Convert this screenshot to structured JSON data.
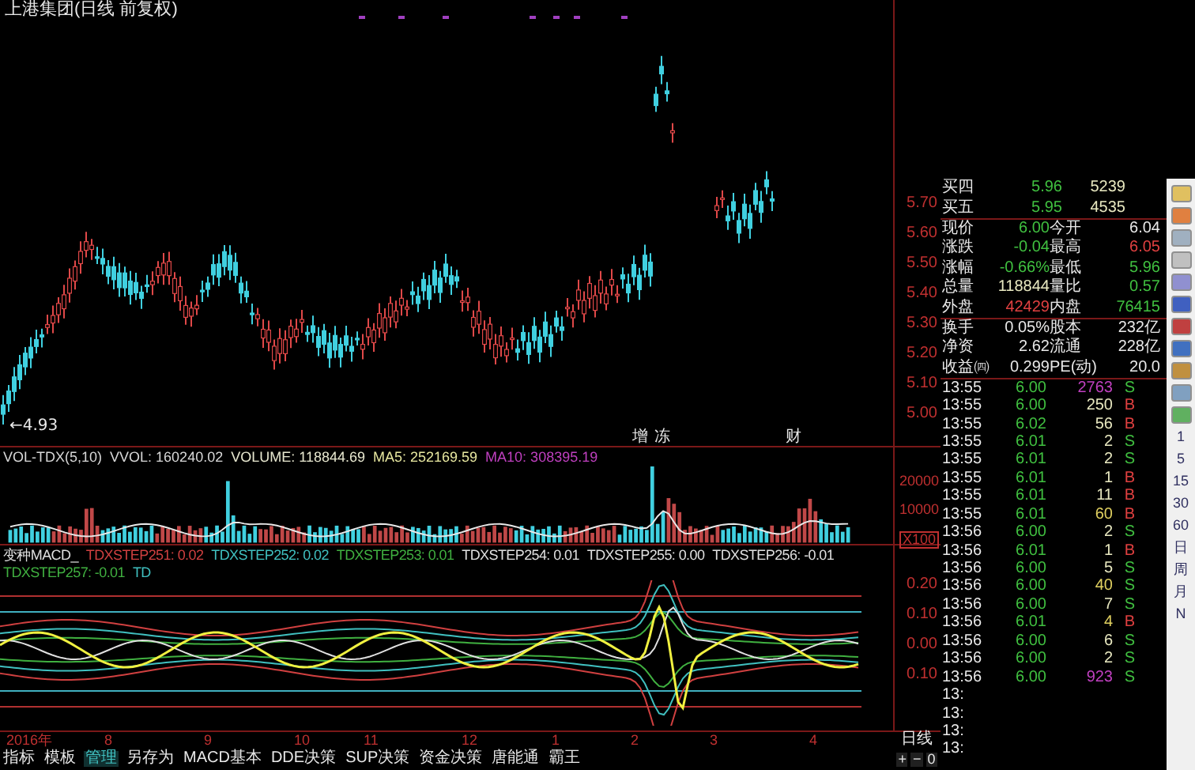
{
  "title": "上港集团(日线 前复权)",
  "low_label": "←4.93",
  "price_axis": [
    "5.70",
    "5.60",
    "5.50",
    "5.40",
    "5.30",
    "5.20",
    "5.10",
    "5.00"
  ],
  "event_marks": [
    {
      "text": "增"
    },
    {
      "text": "冻"
    },
    {
      "text": "财"
    }
  ],
  "volume_legend": [
    {
      "text": "VOL-TDX(5,10)",
      "color": "#d8d8d8"
    },
    {
      "text": "VVOL: 160240.02",
      "color": "#d8d8d8"
    },
    {
      "text": "VOLUME: 118844.69",
      "color": "#e8e8d0"
    },
    {
      "text": "MA5: 252169.59",
      "color": "#e8e8a0"
    },
    {
      "text": "MA10: 308395.19",
      "color": "#c040c0"
    }
  ],
  "volume_axis": [
    "20000",
    "10000",
    "X100"
  ],
  "macd_legend": [
    {
      "text": "变种MACD_",
      "color": "#e0e0e0"
    },
    {
      "text": "TDXSTEP251: 0.02",
      "color": "#d04040"
    },
    {
      "text": "TDXSTEP252: 0.02",
      "color": "#40c0c0"
    },
    {
      "text": "TDXSTEP253: 0.01",
      "color": "#40b040"
    },
    {
      "text": "TDXSTEP254: 0.01",
      "color": "#e0e0e0"
    },
    {
      "text": "TDXSTEP255: 0.00",
      "color": "#e0e0e0"
    },
    {
      "text": "TDXSTEP256: -0.01",
      "color": "#e0e0e0"
    },
    {
      "text": "TDXSTEP257: -0.01",
      "color": "#40b040"
    },
    {
      "text": "TD",
      "color": "#40c0c0"
    }
  ],
  "macd_axis": [
    "0.20",
    "0.10",
    "0.00",
    "0.10"
  ],
  "date_axis": [
    "2016年",
    "8",
    "9",
    "10",
    "11",
    "12",
    "1",
    "2",
    "3",
    "4"
  ],
  "period_label": "日线",
  "zoom_controls": [
    "+",
    "−",
    "0"
  ],
  "tabs": [
    {
      "label": "指标",
      "selected": false
    },
    {
      "label": "模板",
      "selected": false
    },
    {
      "label": "管理",
      "selected": true
    },
    {
      "label": "另存为",
      "selected": false
    },
    {
      "label": "MACD基本",
      "selected": false
    },
    {
      "label": "DDE决策",
      "selected": false
    },
    {
      "label": "SUP决策",
      "selected": false
    },
    {
      "label": "资金决策",
      "selected": false
    },
    {
      "label": "唐能通",
      "selected": false
    },
    {
      "label": "霸王",
      "selected": false
    }
  ],
  "order_book": [
    {
      "label": "买四",
      "price": "5.96",
      "volume": "5239"
    },
    {
      "label": "买五",
      "price": "5.95",
      "volume": "4535"
    }
  ],
  "stats": [
    [
      {
        "label": "现价",
        "value": "6.00",
        "color": "#40c040"
      },
      {
        "label": "今开",
        "value": "6.04",
        "color": "#e8e8e8"
      }
    ],
    [
      {
        "label": "涨跌",
        "value": "-0.04",
        "color": "#40c040"
      },
      {
        "label": "最高",
        "value": "6.05",
        "color": "#e04040"
      }
    ],
    [
      {
        "label": "涨幅",
        "value": "-0.66%",
        "color": "#40c040"
      },
      {
        "label": "最低",
        "value": "5.96",
        "color": "#40c040"
      }
    ],
    [
      {
        "label": "总量",
        "value": "118844",
        "color": "#e8e8c0"
      },
      {
        "label": "量比",
        "value": "0.57",
        "color": "#40c040"
      }
    ],
    [
      {
        "label": "外盘",
        "value": "42429",
        "color": "#e04040"
      },
      {
        "label": "内盘",
        "value": "76415",
        "color": "#40c040"
      }
    ]
  ],
  "fundamentals": [
    [
      {
        "label": "换手",
        "value": "0.05%"
      },
      {
        "label": "股本",
        "value": "232亿"
      }
    ],
    [
      {
        "label": "净资",
        "value": "2.62"
      },
      {
        "label": "流通",
        "value": "228亿"
      }
    ],
    [
      {
        "label": "收益㈣",
        "value": "0.299"
      },
      {
        "label": "PE(动)",
        "value": "20.0"
      }
    ]
  ],
  "ticks": [
    {
      "time": "13:55",
      "price": "6.00",
      "volume": {
        "text": "2763",
        "color": "#c040c0"
      },
      "side": {
        "text": "S",
        "color": "#40c040"
      }
    },
    {
      "time": "13:55",
      "price": "6.00",
      "volume": {
        "text": "250",
        "color": "#e8e8c0"
      },
      "side": {
        "text": "B",
        "color": "#e04040"
      }
    },
    {
      "time": "13:55",
      "price": "6.02",
      "volume": {
        "text": "56",
        "color": "#e8e8c0"
      },
      "side": {
        "text": "B",
        "color": "#e04040"
      }
    },
    {
      "time": "13:55",
      "price": "6.01",
      "volume": {
        "text": "2",
        "color": "#e8e8c0"
      },
      "side": {
        "text": "S",
        "color": "#40c040"
      }
    },
    {
      "time": "13:55",
      "price": "6.01",
      "volume": {
        "text": "2",
        "color": "#e8e8c0"
      },
      "side": {
        "text": "S",
        "color": "#40c040"
      }
    },
    {
      "time": "13:55",
      "price": "6.01",
      "volume": {
        "text": "1",
        "color": "#e8e8c0"
      },
      "side": {
        "text": "B",
        "color": "#e04040"
      }
    },
    {
      "time": "13:55",
      "price": "6.01",
      "volume": {
        "text": "11",
        "color": "#e8e8c0"
      },
      "side": {
        "text": "B",
        "color": "#e04040"
      }
    },
    {
      "time": "13:55",
      "price": "6.01",
      "volume": {
        "text": "60",
        "color": "#e0d060"
      },
      "side": {
        "text": "B",
        "color": "#e04040"
      }
    },
    {
      "time": "13:56",
      "price": "6.00",
      "volume": {
        "text": "2",
        "color": "#e8e8c0"
      },
      "side": {
        "text": "S",
        "color": "#40c040"
      }
    },
    {
      "time": "13:56",
      "price": "6.01",
      "volume": {
        "text": "1",
        "color": "#e8e8c0"
      },
      "side": {
        "text": "B",
        "color": "#e04040"
      }
    },
    {
      "time": "13:56",
      "price": "6.00",
      "volume": {
        "text": "5",
        "color": "#e8e8c0"
      },
      "side": {
        "text": "S",
        "color": "#40c040"
      }
    },
    {
      "time": "13:56",
      "price": "6.00",
      "volume": {
        "text": "40",
        "color": "#e0d060"
      },
      "side": {
        "text": "S",
        "color": "#40c040"
      }
    },
    {
      "time": "13:56",
      "price": "6.00",
      "volume": {
        "text": "7",
        "color": "#e8e8c0"
      },
      "side": {
        "text": "S",
        "color": "#40c040"
      }
    },
    {
      "time": "13:56",
      "price": "6.01",
      "volume": {
        "text": "4",
        "color": "#e0d060"
      },
      "side": {
        "text": "B",
        "color": "#e04040"
      }
    },
    {
      "time": "13:56",
      "price": "6.00",
      "volume": {
        "text": "6",
        "color": "#e8e8c0"
      },
      "side": {
        "text": "S",
        "color": "#40c040"
      }
    },
    {
      "time": "13:56",
      "price": "6.00",
      "volume": {
        "text": "2",
        "color": "#e8e8c0"
      },
      "side": {
        "text": "S",
        "color": "#40c040"
      }
    },
    {
      "time": "13:56",
      "price": "6.00",
      "volume": {
        "text": "923",
        "color": "#c040c0"
      },
      "side": {
        "text": "S",
        "color": "#40c040"
      }
    },
    {
      "time": "13:"
    },
    {
      "time": "13:"
    },
    {
      "time": "13:"
    },
    {
      "time": "13:"
    }
  ],
  "toolbar_periods": [
    "1",
    "5",
    "15",
    "30",
    "60",
    "日",
    "周",
    "月",
    "N"
  ]
}
